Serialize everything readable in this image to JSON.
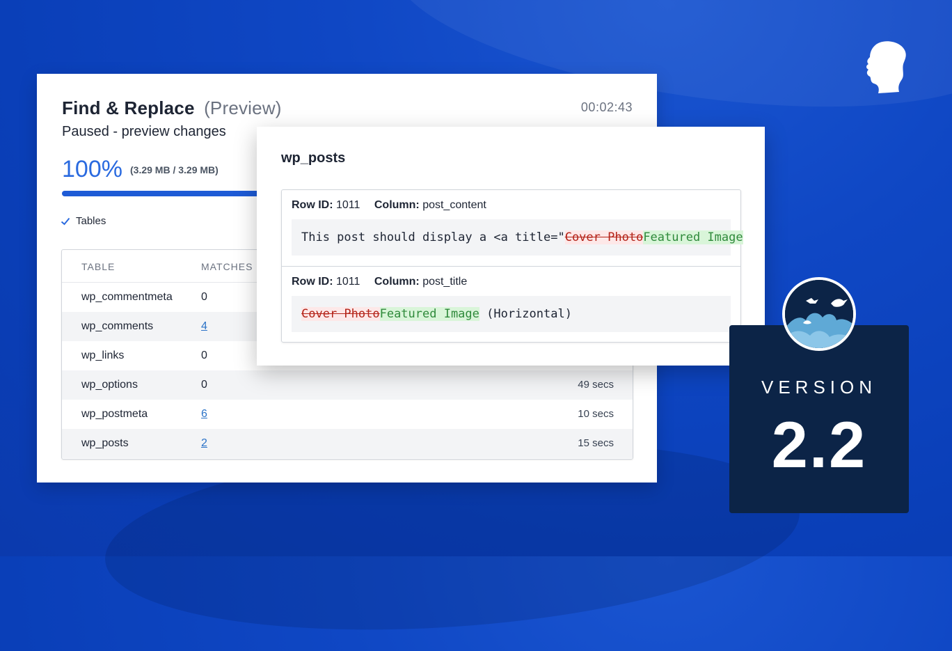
{
  "header": {
    "title": "Find & Replace",
    "title_suffix": "(Preview)",
    "timer": "00:02:43",
    "status": "Paused - preview changes"
  },
  "progress": {
    "percent_label": "100%",
    "size_label": "(3.29 MB / 3.29 MB)",
    "fraction": 1.0
  },
  "stage": {
    "label": "Tables"
  },
  "table": {
    "columns": [
      "TABLE",
      "MATCHES"
    ],
    "rows": [
      {
        "name": "wp_commentmeta",
        "matches": "0",
        "time": ""
      },
      {
        "name": "wp_comments",
        "matches": "4",
        "time": ""
      },
      {
        "name": "wp_links",
        "matches": "0",
        "time": ""
      },
      {
        "name": "wp_options",
        "matches": "0",
        "time": "49 secs"
      },
      {
        "name": "wp_postmeta",
        "matches": "6",
        "time": "10 secs"
      },
      {
        "name": "wp_posts",
        "matches": "2",
        "time": "15 secs"
      }
    ]
  },
  "popup": {
    "title": "wp_posts",
    "entries": [
      {
        "row_label": "Row ID:",
        "row_id": "1011",
        "column_label": "Column:",
        "column": "post_content",
        "prefix": "This post should display a <a title=\"",
        "deleted": "Cover Photo",
        "inserted": "Featured Image",
        "suffix": ""
      },
      {
        "row_label": "Row ID:",
        "row_id": "1011",
        "column_label": "Column:",
        "column": "post_title",
        "prefix": "",
        "deleted": "Cover Photo",
        "inserted": "Featured Image",
        "suffix": " (Horizontal)"
      }
    ]
  },
  "version": {
    "label": "VERSION",
    "number": "2.2"
  },
  "colors": {
    "background": "#0f47c4",
    "accent": "#2a6adf",
    "badge": "#0c2447",
    "deleted": "#b42318",
    "inserted": "#2f8a3b"
  },
  "icons": [
    "check-icon",
    "head-logo-icon",
    "birds-logo-icon"
  ]
}
